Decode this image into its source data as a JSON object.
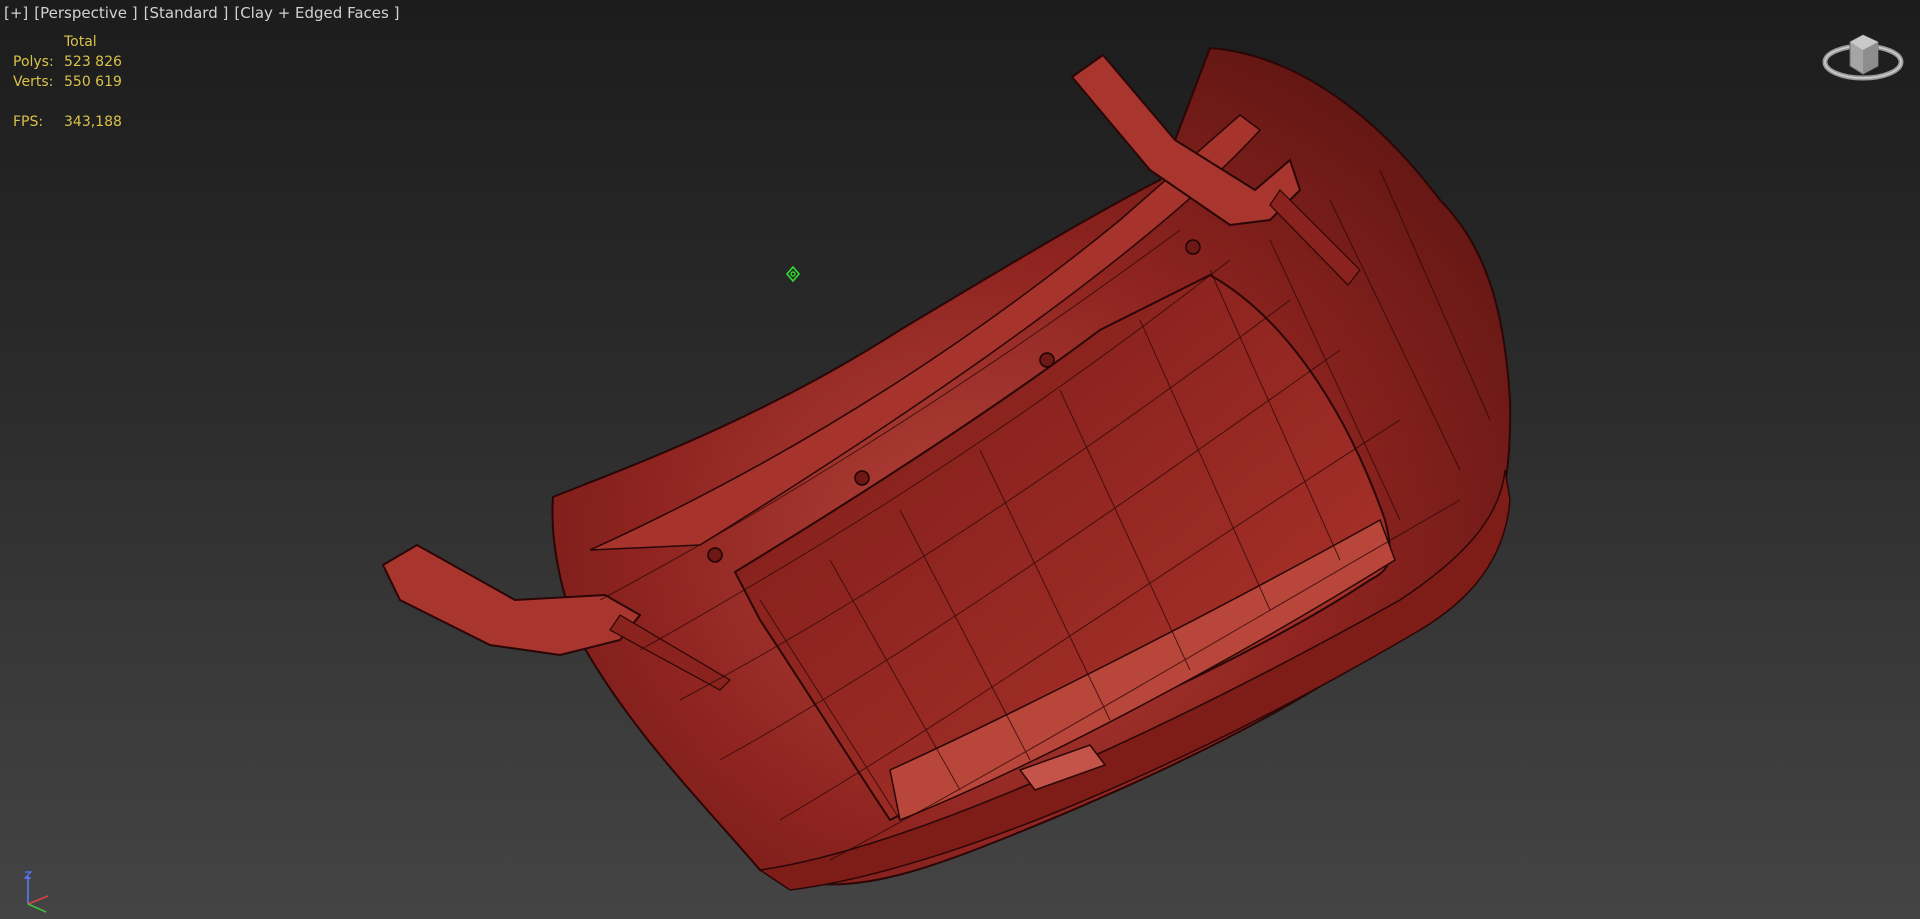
{
  "viewport": {
    "labels": [
      "[+]",
      "[Perspective ]",
      "[Standard ]",
      "[Clay + Edged Faces ]"
    ]
  },
  "stats": {
    "header": "Total",
    "polys_label": "Polys:",
    "polys_value": "523 826",
    "verts_label": "Verts:",
    "verts_value": "550 619",
    "fps_label": "FPS:",
    "fps_value": "343,188"
  },
  "icons": {
    "viewcube": "viewcube-icon",
    "pivot": "pivot-gizmo-icon",
    "axis": "axis-tripod-icon"
  },
  "colors": {
    "stats_text": "#d8c24a",
    "label_text": "#d2d2d2",
    "clay": "#9a2a24",
    "pivot": "#2ee02e"
  }
}
